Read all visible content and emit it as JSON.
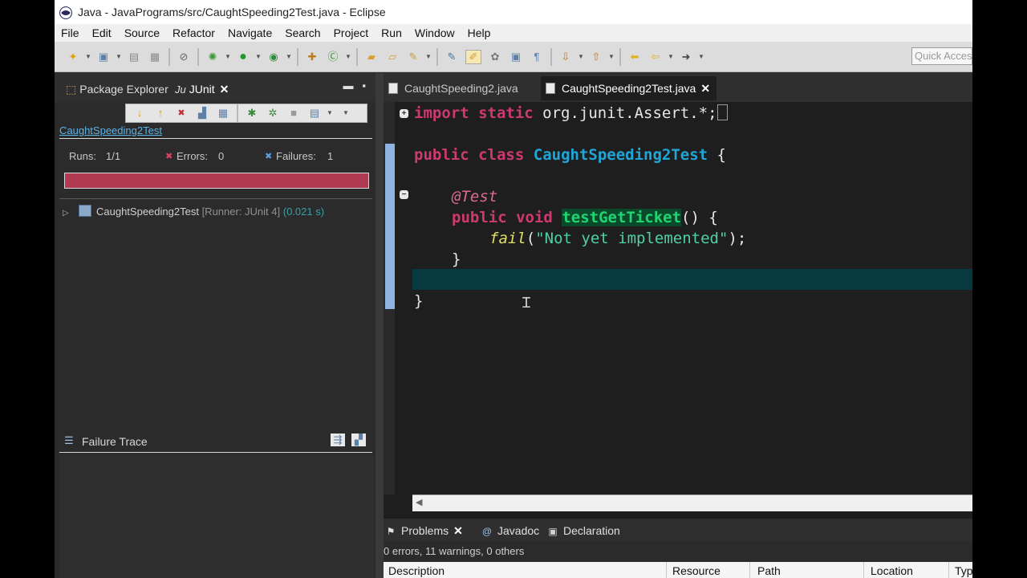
{
  "window": {
    "title": "Java - JavaPrograms/src/CaughtSpeeding2Test.java - Eclipse"
  },
  "menu": [
    "File",
    "Edit",
    "Source",
    "Refactor",
    "Navigate",
    "Search",
    "Project",
    "Run",
    "Window",
    "Help"
  ],
  "toolbar": {
    "quick_access_placeholder": "Quick Access"
  },
  "left_panel": {
    "tabs": {
      "package_explorer": "Package Explorer",
      "junit_icon": "Ju",
      "junit": "JUnit"
    },
    "test_name": "CaughtSpeeding2Test",
    "stats": {
      "runs_label": "Runs:",
      "runs_value": "1/1",
      "errors_label": "Errors:",
      "errors_value": "0",
      "failures_label": "Failures:",
      "failures_value": "1"
    },
    "progress_color": "#b03a52",
    "tree_item": {
      "name": "CaughtSpeeding2Test",
      "runner": "[Runner: JUnit 4]",
      "time": "(0.021 s)"
    },
    "failure_trace_title": "Failure Trace"
  },
  "editor": {
    "tabs": [
      "CaughtSpeeding2.java",
      "CaughtSpeeding2Test.java"
    ],
    "code": {
      "import_kw1": "import",
      "import_kw2": "static",
      "import_rest": " org.junit.Assert.*;",
      "class_kw1": "public",
      "class_kw2": "class",
      "class_name": "CaughtSpeeding2Test",
      "class_open": " {",
      "annotation": "@Test",
      "method_kw1": "public",
      "method_kw2": "void",
      "method_name": "testGetTicket",
      "method_rest": "() {",
      "fail_call": "fail",
      "fail_paren_open": "(",
      "fail_string": "\"Not yet implemented\"",
      "fail_paren_close": ");",
      "method_close": "}",
      "class_close": "}"
    }
  },
  "bottom_panel": {
    "tabs": [
      "Problems",
      "Javadoc",
      "Declaration"
    ],
    "summary": "0 errors, 11 warnings, 0 others",
    "columns": [
      "Description",
      "Resource",
      "Path",
      "Location",
      "Typ"
    ]
  }
}
